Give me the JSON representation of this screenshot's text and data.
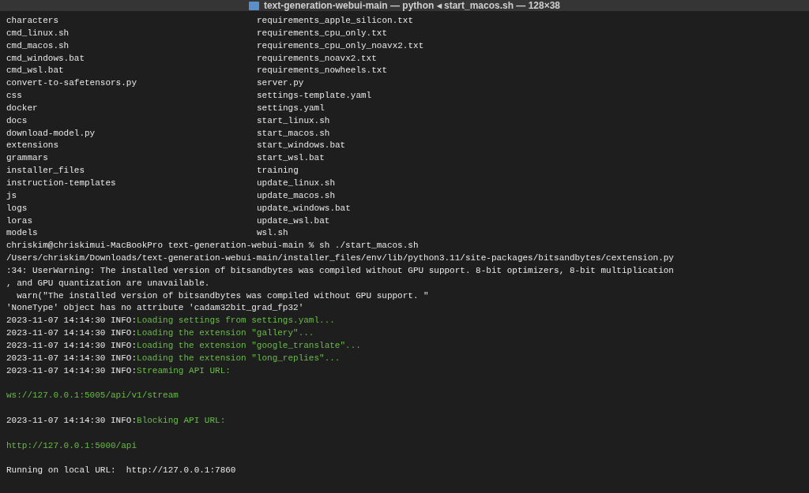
{
  "window": {
    "title": "text-generation-webui-main — python ◂ start_macos.sh — 128×38"
  },
  "lines": [
    {
      "kind": "listing",
      "left": "characters",
      "right": "requirements_apple_silicon.txt"
    },
    {
      "kind": "listing",
      "left": "cmd_linux.sh",
      "right": "requirements_cpu_only.txt"
    },
    {
      "kind": "listing",
      "left": "cmd_macos.sh",
      "right": "requirements_cpu_only_noavx2.txt"
    },
    {
      "kind": "listing",
      "left": "cmd_windows.bat",
      "right": "requirements_noavx2.txt"
    },
    {
      "kind": "listing",
      "left": "cmd_wsl.bat",
      "right": "requirements_nowheels.txt"
    },
    {
      "kind": "listing",
      "left": "convert-to-safetensors.py",
      "right": "server.py"
    },
    {
      "kind": "listing",
      "left": "css",
      "right": "settings-template.yaml"
    },
    {
      "kind": "listing",
      "left": "docker",
      "right": "settings.yaml"
    },
    {
      "kind": "listing",
      "left": "docs",
      "right": "start_linux.sh"
    },
    {
      "kind": "listing",
      "left": "download-model.py",
      "right": "start_macos.sh"
    },
    {
      "kind": "listing",
      "left": "extensions",
      "right": "start_windows.bat"
    },
    {
      "kind": "listing",
      "left": "grammars",
      "right": "start_wsl.bat"
    },
    {
      "kind": "listing",
      "left": "installer_files",
      "right": "training"
    },
    {
      "kind": "listing",
      "left": "instruction-templates",
      "right": "update_linux.sh"
    },
    {
      "kind": "listing",
      "left": "js",
      "right": "update_macos.sh"
    },
    {
      "kind": "listing",
      "left": "logs",
      "right": "update_windows.bat"
    },
    {
      "kind": "listing",
      "left": "loras",
      "right": "update_wsl.bat"
    },
    {
      "kind": "listing",
      "left": "models",
      "right": "wsl.sh"
    },
    {
      "kind": "text",
      "text": "chriskim@chriskimui-MacBookPro text-generation-webui-main % sh ./start_macos.sh"
    },
    {
      "kind": "text",
      "text": "/Users/chriskim/Downloads/text-generation-webui-main/installer_files/env/lib/python3.11/site-packages/bitsandbytes/cextension.py"
    },
    {
      "kind": "text",
      "text": ":34: UserWarning: The installed version of bitsandbytes was compiled without GPU support. 8-bit optimizers, 8-bit multiplication"
    },
    {
      "kind": "text",
      "text": ", and GPU quantization are unavailable."
    },
    {
      "kind": "text",
      "text": "  warn(\"The installed version of bitsandbytes was compiled without GPU support. \""
    },
    {
      "kind": "text",
      "text": "'NoneType' object has no attribute 'cadam32bit_grad_fp32'"
    },
    {
      "kind": "log",
      "prefix": "2023-11-07 14:14:30 INFO:",
      "message": "Loading settings from settings.yaml..."
    },
    {
      "kind": "log",
      "prefix": "2023-11-07 14:14:30 INFO:",
      "message": "Loading the extension \"gallery\"..."
    },
    {
      "kind": "log",
      "prefix": "2023-11-07 14:14:30 INFO:",
      "message": "Loading the extension \"google_translate\"..."
    },
    {
      "kind": "log",
      "prefix": "2023-11-07 14:14:30 INFO:",
      "message": "Loading the extension \"long_replies\"..."
    },
    {
      "kind": "log",
      "prefix": "2023-11-07 14:14:30 INFO:",
      "message": "Streaming API URL:"
    },
    {
      "kind": "blank"
    },
    {
      "kind": "url",
      "text": "ws://127.0.0.1:5005/api/v1/stream"
    },
    {
      "kind": "blank"
    },
    {
      "kind": "log",
      "prefix": "2023-11-07 14:14:30 INFO:",
      "message": "Blocking API URL:"
    },
    {
      "kind": "blank"
    },
    {
      "kind": "url",
      "text": "http://127.0.0.1:5000/api"
    },
    {
      "kind": "blank"
    },
    {
      "kind": "text",
      "text": "Running on local URL:  http://127.0.0.1:7860"
    }
  ]
}
